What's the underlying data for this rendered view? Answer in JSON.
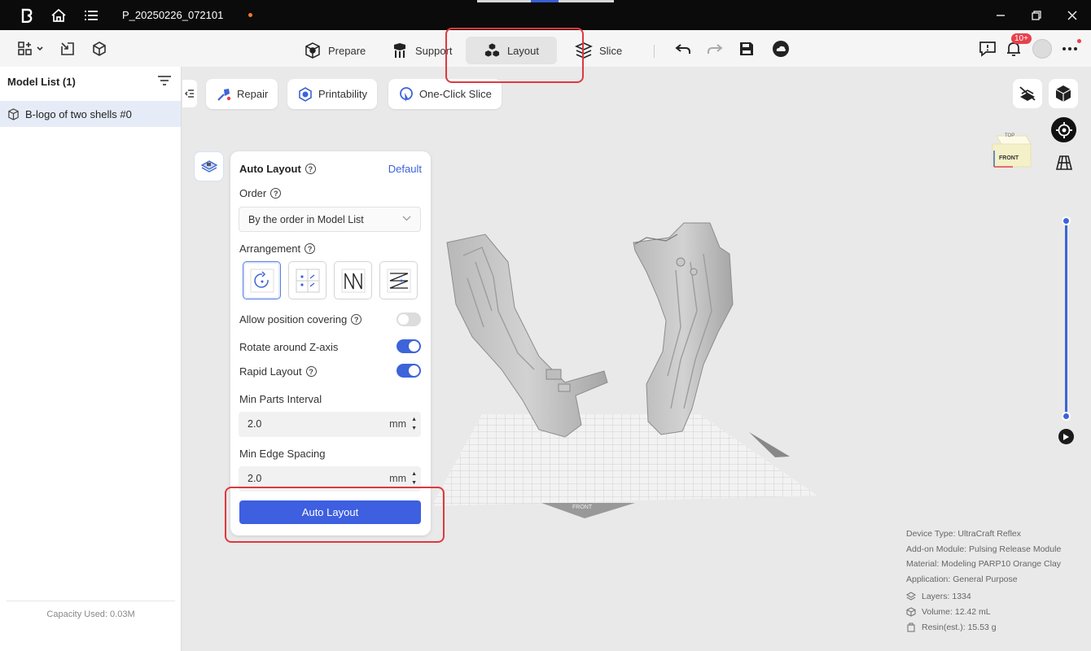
{
  "titlebar": {
    "project": "P_20250226_072101",
    "icons": [
      "app-logo-icon",
      "home-icon",
      "list-menu-icon",
      "minimize-icon",
      "restore-icon",
      "close-icon"
    ]
  },
  "toolbar": {
    "tabs": [
      {
        "label": "Prepare",
        "icon": "prepare-icon"
      },
      {
        "label": "Support",
        "icon": "support-icon"
      },
      {
        "label": "Layout",
        "icon": "layout-icon",
        "active": true
      },
      {
        "label": "Slice",
        "icon": "slice-icon"
      }
    ],
    "notification_badge": "10+"
  },
  "sidebar": {
    "title": "Model List (1)",
    "items": [
      {
        "label": "B-logo of two shells #0"
      }
    ],
    "capacity": "Capacity Used: 0.03M"
  },
  "actions": {
    "repair": "Repair",
    "printability": "Printability",
    "one_click_slice": "One-Click Slice"
  },
  "panel": {
    "title": "Auto Layout",
    "default_link": "Default",
    "order_label": "Order",
    "order_value": "By the order in Model List",
    "arrangement_label": "Arrangement",
    "arrangement_options": [
      "spiral-arrangement-icon",
      "grid-arrangement-icon",
      "zigzag-arrangement-icon",
      "snake-arrangement-icon"
    ],
    "allow_covering_label": "Allow position covering",
    "allow_covering_on": false,
    "rotate_label": "Rotate around Z-axis",
    "rotate_on": true,
    "rapid_label": "Rapid Layout",
    "rapid_on": true,
    "min_parts_label": "Min Parts Interval",
    "min_parts_value": "2.0",
    "min_edge_label": "Min Edge Spacing",
    "min_edge_value": "2.0",
    "unit": "mm",
    "button": "Auto Layout"
  },
  "view_cube": {
    "top": "TOP",
    "front": "FRONT"
  },
  "plate_label": "FRONT",
  "device_info": {
    "device_type": "Device Type:  UltraCraft Reflex",
    "addon": "Add-on Module:  Pulsing Release Module",
    "material": "Material:  Modeling PARP10 Orange Clay",
    "application": "Application:  General Purpose",
    "layers": "Layers: 1334",
    "volume": "Volume: 12.42 mL",
    "resin": "Resin(est.): 15.53 g"
  },
  "colors": {
    "accent": "#3d64d8",
    "highlight": "#e0383d",
    "titlebar": "#0b0b0b"
  }
}
